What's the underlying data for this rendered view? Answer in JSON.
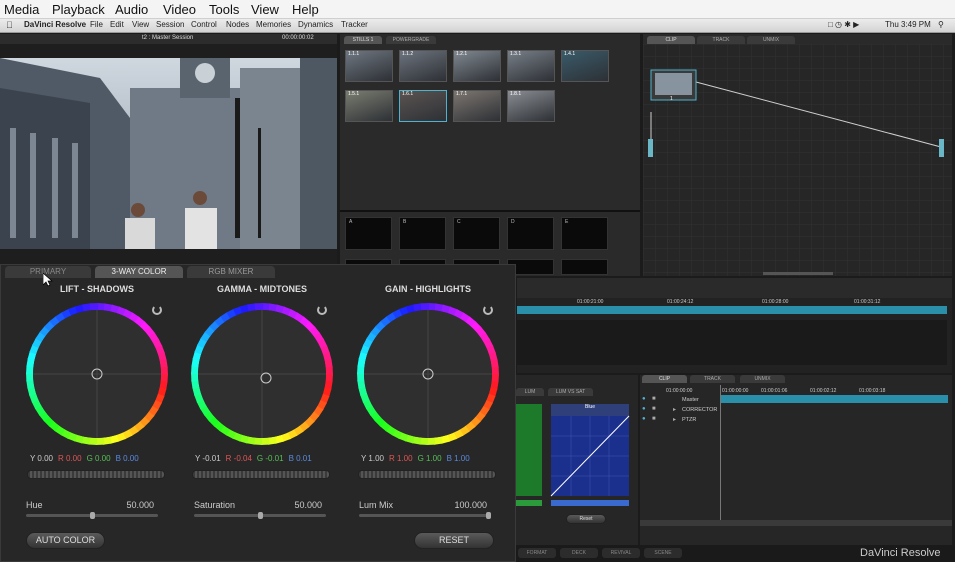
{
  "top_menu": [
    "Media",
    "Playback",
    "Audio",
    "Video",
    "Tools",
    "View",
    "Help"
  ],
  "app_menu": {
    "app_name": "DaVinci Resolve",
    "items": [
      "File",
      "Edit",
      "View",
      "Session",
      "Control",
      "Nodes",
      "Memories",
      "Dynamics",
      "Tracker"
    ],
    "clock": "Thu 3:49 PM"
  },
  "viewer": {
    "title": "t2 : Master Session",
    "timecode": "00:00:00:02"
  },
  "gallery": {
    "tabs": [
      "STILLS 1",
      "POWERGRADE"
    ],
    "stills": [
      "1.1.1",
      "1.1.2",
      "1.2.1",
      "1.3.1",
      "1.4.1",
      "1.5.1",
      "1.6.1",
      "1.7.1",
      "1.8.1"
    ],
    "memories": [
      "A",
      "B",
      "C",
      "D",
      "E"
    ]
  },
  "node_editor": {
    "tabs": [
      "CLIP",
      "TRACK",
      "UNMIX"
    ],
    "node_label": "1"
  },
  "timeline": {
    "ticks": [
      "01:00:21:00",
      "01:00:24:12",
      "01:00:28:00",
      "01:00:31:12"
    ]
  },
  "color_tabs": [
    "PRIMARY",
    "3-WAY COLOR",
    "RGB MIXER"
  ],
  "wheels": [
    {
      "title": "LIFT - SHADOWS",
      "y": "Y 0.00",
      "r": "R 0.00",
      "g": "G 0.00",
      "b": "B 0.00"
    },
    {
      "title": "GAMMA - MIDTONES",
      "y": "Y -0.01",
      "r": "R -0.04",
      "g": "G -0.01",
      "b": "B 0.01"
    },
    {
      "title": "GAIN - HIGHLIGHTS",
      "y": "Y 1.00",
      "r": "R 1.00",
      "g": "G 1.00",
      "b": "B 1.00"
    }
  ],
  "params": [
    {
      "label": "Hue",
      "value": "50.000",
      "level": 0.5
    },
    {
      "label": "Saturation",
      "value": "50.000",
      "level": 0.5
    },
    {
      "label": "Lum Mix",
      "value": "100.000",
      "level": 1.0
    }
  ],
  "buttons": {
    "auto_color": "AUTO COLOR",
    "reset": "RESET"
  },
  "curves": {
    "tabs": [
      "LUM",
      "LUM VS SAT"
    ],
    "channel": "Blue",
    "reset": "Reset"
  },
  "keyframes": {
    "tabs": [
      "CLIP",
      "TRACK",
      "UNMIX"
    ],
    "ticks": [
      "01:00:00:00",
      "01:00:00:00",
      "01:00:01:06",
      "01:00:02:12",
      "01:00:03:18"
    ],
    "tracks": [
      "Master",
      "CORRECTOR",
      "PTZR"
    ]
  },
  "bottom_tabs": [
    "FORMAT",
    "DECK",
    "REVIVAL",
    "SCENE"
  ],
  "brand": "DaVinci Resolve",
  "colors": {
    "accent": "#2a8fa8",
    "panel": "#262626"
  }
}
